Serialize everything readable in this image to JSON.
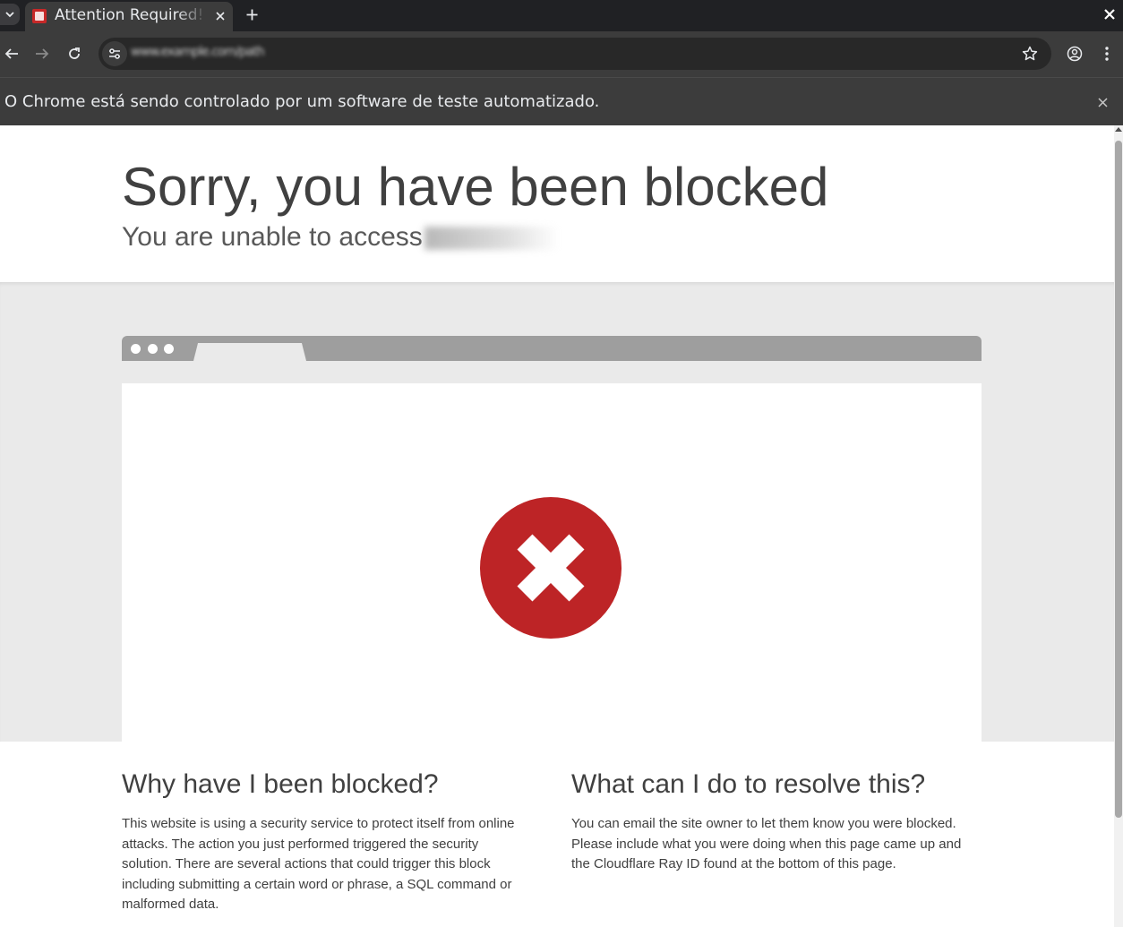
{
  "browser": {
    "tab": {
      "title": "Attention Required! | Cloudflare"
    },
    "address_bar": {
      "url_text": "www.example.com/path"
    },
    "automation_infobar": {
      "text": "O Chrome está sendo controlado por um software de teste automatizado."
    }
  },
  "page": {
    "title": "Sorry, you have been blocked",
    "subtitle_prefix": "You are unable to access",
    "why_blocked": {
      "heading": "Why have I been blocked?",
      "body": "This website is using a security service to protect itself from online attacks. The action you just performed triggered the security solution. There are several actions that could trigger this block including submitting a certain word or phrase, a SQL command or malformed data."
    },
    "resolve": {
      "heading": "What can I do to resolve this?",
      "body": "You can email the site owner to let them know you were blocked. Please include what you were doing when this page came up and the Cloudflare Ray ID found at the bottom of this page."
    }
  },
  "colors": {
    "blocked_red": "#bd2426",
    "heading_text": "#404040",
    "gray_band": "#eaeaea"
  },
  "icons": [
    "tab-search-icon",
    "favicon-icon",
    "close-icon",
    "plus-icon",
    "back-arrow-icon",
    "forward-arrow-icon",
    "reload-icon",
    "site-info-icon",
    "star-icon",
    "profile-icon",
    "kebab-menu-icon",
    "blocked-x-icon"
  ]
}
